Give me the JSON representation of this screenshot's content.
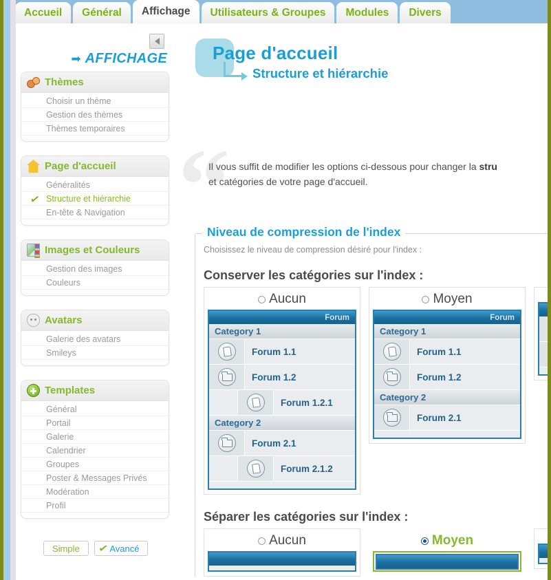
{
  "window": {
    "tab_bar_color": "#8fbddf",
    "border_color": "#7d8b1e"
  },
  "tabs": [
    {
      "label": "Accueil",
      "active": false
    },
    {
      "label": "Général",
      "active": false
    },
    {
      "label": "Affichage",
      "active": true
    },
    {
      "label": "Utilisateurs & Groupes",
      "active": false
    },
    {
      "label": "Modules",
      "active": false
    },
    {
      "label": "Divers",
      "active": false
    }
  ],
  "sidebar": {
    "collapse_button_title": "◀",
    "section_label": "AFFICHAGE",
    "panels": [
      {
        "title": "Thèmes",
        "icon": "palette-icon",
        "items": [
          {
            "label": "Choisir un thème",
            "active": false
          },
          {
            "label": "Gestion des thèmes",
            "active": false
          },
          {
            "label": "Thèmes temporaires",
            "active": false
          }
        ]
      },
      {
        "title": "Page d'accueil",
        "icon": "home-icon",
        "items": [
          {
            "label": "Généralités",
            "active": false
          },
          {
            "label": "Structure et hiérarchie",
            "active": true
          },
          {
            "label": "En-tête & Navigation",
            "active": false
          }
        ]
      },
      {
        "title": "Images et Couleurs",
        "icon": "images-colors-icon",
        "items": [
          {
            "label": "Gestion des images",
            "active": false
          },
          {
            "label": "Couleurs",
            "active": false
          }
        ]
      },
      {
        "title": "Avatars",
        "icon": "avatar-icon",
        "items": [
          {
            "label": "Galerie des avatars",
            "active": false
          },
          {
            "label": "Smileys",
            "active": false
          }
        ]
      },
      {
        "title": "Templates",
        "icon": "plus-circle-icon",
        "items": [
          {
            "label": "Général",
            "active": false
          },
          {
            "label": "Portail",
            "active": false
          },
          {
            "label": "Galerie",
            "active": false
          },
          {
            "label": "Calendrier",
            "active": false
          },
          {
            "label": "Groupes",
            "active": false
          },
          {
            "label": "Poster & Messages Privés",
            "active": false
          },
          {
            "label": "Modération",
            "active": false
          },
          {
            "label": "Profil",
            "active": false
          }
        ]
      }
    ],
    "mode_buttons": {
      "simple": "Simple",
      "advanced": "Avancé"
    }
  },
  "main": {
    "title": "Page d'accueil",
    "subtitle": "Structure et hiérarchie",
    "intro_line1_a": "Il vous suffit de modifier les options ci-dessous pour changer la ",
    "intro_line1_b": "stru",
    "intro_line2": "et catégories de votre page d'accueil.",
    "fieldset": {
      "legend": "Niveau de compression de l'index",
      "note": "Choisissez le niveau de compression désiré pour l'index :",
      "groups": [
        {
          "label": "Conserver les catégories sur l'index :",
          "options": [
            {
              "value": "Aucun",
              "selected": false,
              "preview": {
                "bar": "Forum",
                "rows": [
                  {
                    "kind": "category",
                    "label": "Category 1"
                  },
                  {
                    "kind": "forum",
                    "label": "Forum 1.1",
                    "icon": "page-icon",
                    "indent": 0
                  },
                  {
                    "kind": "forum",
                    "label": "Forum 1.2",
                    "icon": "folder-icon",
                    "indent": 0
                  },
                  {
                    "kind": "forum",
                    "label": "Forum 1.2.1",
                    "icon": "page-icon",
                    "indent": 1
                  },
                  {
                    "kind": "category",
                    "label": "Category 2"
                  },
                  {
                    "kind": "forum",
                    "label": "Forum 2.1",
                    "icon": "folder-icon",
                    "indent": 0
                  },
                  {
                    "kind": "forum",
                    "label": "Forum 2.1.2",
                    "icon": "page-icon",
                    "indent": 1
                  }
                ]
              }
            },
            {
              "value": "Moyen",
              "selected": false,
              "preview": {
                "bar": "Forum",
                "rows": [
                  {
                    "kind": "category",
                    "label": "Category 1"
                  },
                  {
                    "kind": "forum",
                    "label": "Forum 1.1",
                    "icon": "page-icon",
                    "indent": 0
                  },
                  {
                    "kind": "forum",
                    "label": "Forum 1.2",
                    "icon": "folder-icon",
                    "indent": 0
                  },
                  {
                    "kind": "category",
                    "label": "Category 2"
                  },
                  {
                    "kind": "forum",
                    "label": "Forum 2.1",
                    "icon": "folder-icon",
                    "indent": 0
                  }
                ]
              }
            },
            {
              "value": "",
              "selected": false,
              "clipped": true,
              "preview": {
                "bar": "",
                "rows": [
                  {
                    "kind": "forum",
                    "label": "",
                    "icon": "folder-icon",
                    "indent": 0
                  },
                  {
                    "kind": "forum",
                    "label": "",
                    "icon": "folder-icon",
                    "indent": 0
                  }
                ]
              }
            }
          ]
        },
        {
          "label": "Séparer les catégories sur l'index :",
          "options": [
            {
              "value": "Aucun",
              "selected": false
            },
            {
              "value": "Moyen",
              "selected": true
            },
            {
              "value": "",
              "selected": false,
              "clipped": true
            }
          ]
        }
      ]
    }
  }
}
